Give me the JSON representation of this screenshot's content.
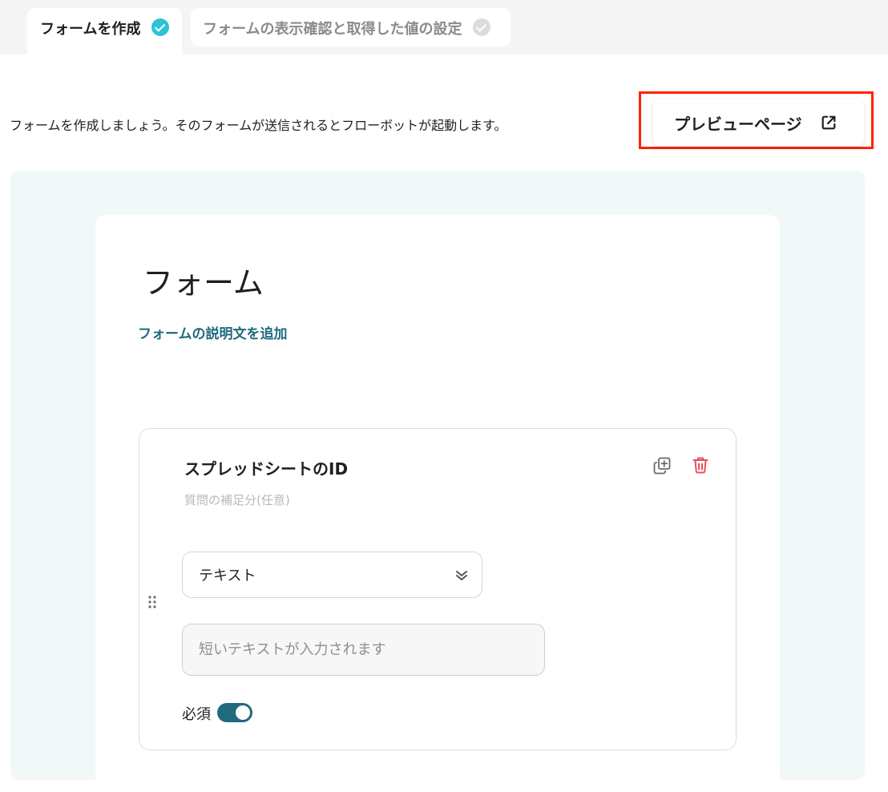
{
  "tabs": [
    {
      "label": "フォームを作成",
      "status": "done"
    },
    {
      "label": "フォームの表示確認と取得した値の設定",
      "status": "todo"
    }
  ],
  "instruction": "フォームを作成しましょう。そのフォームが送信されるとフローボットが起動します。",
  "preview_button": {
    "label": "プレビューページ",
    "icon": "external-link-icon"
  },
  "form": {
    "title": "フォーム",
    "add_description_label": "フォームの説明文を追加"
  },
  "question": {
    "title": "スプレッドシートのID",
    "hint": "質問の補足分(任意)",
    "type_selected": "テキスト",
    "answer_placeholder": "短いテキストが入力されます",
    "required_label": "必須",
    "required": true
  },
  "colors": {
    "accent": "#1f6a7c",
    "check_done": "#2cc3d6",
    "check_todo": "#dcdcdc",
    "highlight": "#ff2200",
    "trash": "#e8505b",
    "form_area_bg": "#f1f9f8"
  }
}
